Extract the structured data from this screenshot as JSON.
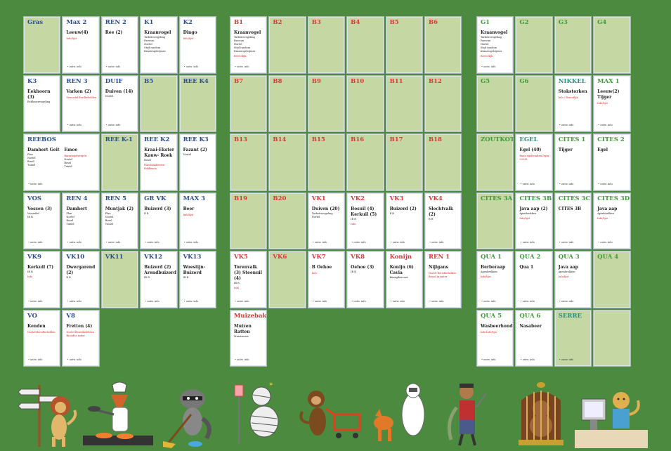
{
  "board": {
    "left": [
      {
        "title": "Gras",
        "empty": true
      },
      {
        "title": "Max 2",
        "animal": "Leeuw(4)",
        "red": "Info/lijst",
        "footer": "• ontw. info"
      },
      {
        "title": "REN 2",
        "animal": "Ree (2)",
        "footer": "• ontw. info"
      },
      {
        "title": "K1",
        "animal": "Kraanvogel",
        "notes": [
          "Tarbeirsvogeling",
          "Paercan",
          "Nortel",
          "Stad random",
          "Kraaivogelcijmes"
        ]
      },
      {
        "title": "K2",
        "animal": "Dingo",
        "red": "Info/lijst",
        "footer": "• ontw. info"
      },
      {
        "title": "K3",
        "animal": "Eekhoorn (3)",
        "notes": [
          "Eekhoornvogeling"
        ]
      },
      {
        "title": "REN 3",
        "animal": "Varken (2)",
        "red": "Stenusfal Berdbehelden",
        "footer": "• ontw. info"
      },
      {
        "title": "DUIF",
        "animal": "Duiven (14)",
        "notes": [
          "Nortel"
        ],
        "footer": "• ontw. info"
      },
      {
        "title": "B5",
        "empty": true
      },
      {
        "title": "REE K4",
        "empty": true
      },
      {
        "title": "REEBOS",
        "wide": true,
        "cols": [
          {
            "animal": "Damhert Geit",
            "notes": [
              "Plan",
              "Nortel",
              "Bosel",
              "Tuinel"
            ]
          },
          {
            "animal": "Emoe",
            "red": "Baraviogelvergels",
            "notes": [
              "Nortel",
              "Bosel",
              "Tuinel"
            ]
          }
        ],
        "footer": "• ontw. info"
      },
      {
        "title": "REE K-1",
        "empty": true
      },
      {
        "title": "REE K2",
        "animal": "Kraai-Ekster Kauw- Roek",
        "red": "Rius familienten Bokkenen",
        "notes": [
          "Bosel"
        ]
      },
      {
        "title": "REE K3",
        "animal": "Fazant (2)",
        "notes": [
          "Nortel"
        ]
      },
      {
        "title": "VOS",
        "animal": "Vossen (3)",
        "notes": [
          "Vossenfel",
          "IR R"
        ],
        "footer": "• ontw. info"
      },
      {
        "title": "REN 4",
        "animal": "Damhert",
        "notes": [
          "Plan",
          "Nortel",
          "Bosel",
          "Tuinel"
        ],
        "footer": "• ontw. info"
      },
      {
        "title": "REN 5",
        "animal": "Muntjak (2)",
        "notes": [
          "Plan",
          "Nortel",
          "Bosel",
          "Tuinel"
        ],
        "footer": "• ontw. info"
      },
      {
        "title": "GR VK",
        "animal": "Buizerd (3)",
        "notes": [
          "R R"
        ],
        "footer": "• ontw. info"
      },
      {
        "title": "MAX 3",
        "animal": "Beer",
        "red": "Info/lijst",
        "footer": "• ontw. info"
      },
      {
        "title": "VK9",
        "animal": "Kerkuil (7)",
        "notes": [
          "IR R"
        ],
        "red": "Info",
        "footer": "• ontw. info"
      },
      {
        "title": "VK10",
        "animal": "Dwergarend (2)",
        "notes": [
          "R R"
        ],
        "footer": "• ontw. info"
      },
      {
        "title": "VK11",
        "empty": true
      },
      {
        "title": "VK12",
        "animal": "Buizerd (2) Arendbuizerd",
        "notes": [
          "IR R"
        ],
        "footer": "• ontw. info"
      },
      {
        "title": "VK13",
        "animal": "Woestijn-Buizerd",
        "notes": [
          "IR R"
        ],
        "footer": "• ontw. info"
      },
      {
        "title": "VO",
        "animal": "Kenden",
        "red": "Nortel Beredbehelden",
        "footer": "• ontw. info"
      },
      {
        "title": "V8",
        "animal": "Fretten (4)",
        "red": "Nortel Beredbehelden Brood in ruiter",
        "footer": "• ontw. info"
      }
    ],
    "middle": [
      {
        "title": "B1",
        "animal": "Kraanvogel",
        "notes": [
          "Tarbeirsvogeling",
          "Paercan",
          "Nortel",
          "Stad random",
          "Kraaivogelcijmes"
        ],
        "red": "Bereotlijk",
        "footer": "• ontw. info"
      },
      {
        "title": "B2",
        "empty": true
      },
      {
        "title": "B3",
        "empty": true
      },
      {
        "title": "B4",
        "empty": true
      },
      {
        "title": "B5",
        "empty": true
      },
      {
        "title": "B6",
        "empty": true
      },
      {
        "title": "B7",
        "empty": true
      },
      {
        "title": "B8",
        "empty": true
      },
      {
        "title": "B9",
        "empty": true
      },
      {
        "title": "B10",
        "empty": true
      },
      {
        "title": "B11",
        "empty": true
      },
      {
        "title": "B12",
        "empty": true
      },
      {
        "title": "B13",
        "empty": true
      },
      {
        "title": "B14",
        "empty": true
      },
      {
        "title": "B15",
        "empty": true
      },
      {
        "title": "B16",
        "empty": true
      },
      {
        "title": "B17",
        "empty": true
      },
      {
        "title": "B18",
        "empty": true
      },
      {
        "title": "B19",
        "empty": true
      },
      {
        "title": "B20",
        "empty": true
      },
      {
        "title": "VK1",
        "animal": "Duiven (20)",
        "notes": [
          "Tarbeirsvogeling",
          "Nortel"
        ],
        "footer": "• ontw. info"
      },
      {
        "title": "VK2",
        "animal": "Bosuil (4) Kerkuil (5)",
        "notes": [
          "IR R"
        ],
        "red": "Info",
        "footer": "• ontw. info"
      },
      {
        "title": "VK3",
        "animal": "Buizerd (2)",
        "notes": [
          "R R"
        ],
        "footer": "• ontw. info"
      },
      {
        "title": "VK4",
        "animal": "Slechtvalk (2)",
        "notes": [
          "R R"
        ],
        "footer": "• ontw. info"
      },
      {
        "title": "VK5",
        "animal": "Torenvalk (3) Steenuil (4)",
        "notes": [
          "IR R"
        ],
        "red": "Info",
        "footer": "• ontw. info"
      },
      {
        "title": "VK6",
        "empty": true
      },
      {
        "title": "VK7",
        "animal": "B Oehoe",
        "red": "Info",
        "footer": "• ontw. info"
      },
      {
        "title": "VK8",
        "animal": "Oehoe (3)",
        "notes": [
          "IR R"
        ],
        "footer": "• ontw. info"
      },
      {
        "title": "Konijn",
        "animal": "Konijn (6) Cavia",
        "notes": [
          "Knaagdiervoer"
        ],
        "footer": "• ontw. info"
      },
      {
        "title": "REN 1",
        "animal": "Nijlgans",
        "red": "Nortel Beredbehelden Brood in ruiter",
        "footer": "• ontw. info"
      },
      {
        "title": "Muizebak",
        "animal": "Muizen Ratten",
        "notes": [
          "Muizenvoer"
        ],
        "footer": "• ontw. info"
      }
    ],
    "right": [
      {
        "title": "G1",
        "animal": "Kraanvogel",
        "notes": [
          "Tarbeirsvogeling",
          "Paercan",
          "Nortel",
          "Stad random",
          "Kraaivogelcijmes"
        ],
        "red": "Bereotlijk",
        "footer": "• ontw. info"
      },
      {
        "title": "G2",
        "empty": true
      },
      {
        "title": "G3",
        "empty": true
      },
      {
        "title": "G4",
        "empty": true
      },
      {
        "title": "G5",
        "empty": true
      },
      {
        "title": "G6",
        "empty": true
      },
      {
        "title": "NIKKEL",
        "animal": "Stokstorken",
        "red": "Info / Bereotlijk",
        "footer": "• ontw. info"
      },
      {
        "title": "MAX 1",
        "animal": "Leeuw(2) Tijger",
        "red": "Info/lijst",
        "footer": "• ontw. info"
      },
      {
        "title": "ZOUTKOT",
        "empty": true
      },
      {
        "title": "EGEL",
        "animal": "Egel (40)",
        "red": "Ruen egeltendren Dgsu 33338",
        "footer": "• ontw. info"
      },
      {
        "title": "CITES 1",
        "animal": "Tijger",
        "footer": "• ontw. info"
      },
      {
        "title": "CITES 2",
        "animal": "Egel",
        "footer": "• ontw. info"
      },
      {
        "title": "CITES 3A",
        "empty": true
      },
      {
        "title": "CITES 3B",
        "animal": "Java aap (2)",
        "notes": [
          "Apenbrokken"
        ],
        "red": "Info/lijst",
        "footer": "• ontw. info"
      },
      {
        "title": "CITES 3C",
        "animal": "CITES 3B",
        "footer": "• ontw. info"
      },
      {
        "title": "CITES 3D",
        "animal": "Java aap",
        "notes": [
          "Apenbrokken"
        ],
        "red": "Info/lijst",
        "footer": "• ontw. info"
      },
      {
        "title": "QUA 1",
        "animal": "Berberaap",
        "notes": [
          "Apenbrokken"
        ],
        "red": "Info/lijst",
        "footer": "• ontw. info"
      },
      {
        "title": "QUA 2",
        "animal": "Qua 1",
        "footer": "• ontw. info"
      },
      {
        "title": "QUA 3",
        "animal": "Java aap",
        "notes": [
          "Apenbrokken"
        ],
        "red": "Info/lijst",
        "footer": "• ontw. info"
      },
      {
        "title": "QUA 4",
        "empty": true
      },
      {
        "title": "QUA 5",
        "animal": "Wasbeerhond",
        "red": "Info  Info/lijst",
        "footer": "• ontw. info"
      },
      {
        "title": "QUA 6",
        "animal": "Nasabeer",
        "footer": "• ontw. info"
      },
      {
        "title": "SERRE",
        "empty": true,
        "footer": "• ontw. info"
      },
      {
        "title": "",
        "empty": true
      }
    ]
  },
  "mascots": [
    "lion-signpost",
    "fox-chef",
    "raccoon-sweeper",
    "mummy-patient",
    "monkey-shopping",
    "fox-hazmat",
    "pirate-dog",
    "monkey-cage",
    "cheetah-computer"
  ],
  "colors": {
    "background": "#4b8a3f",
    "empty_cell": "#c5d8a3",
    "red_title": "#d83838",
    "blue_title": "#2a4c8f",
    "green_title": "#3f9a3a"
  }
}
